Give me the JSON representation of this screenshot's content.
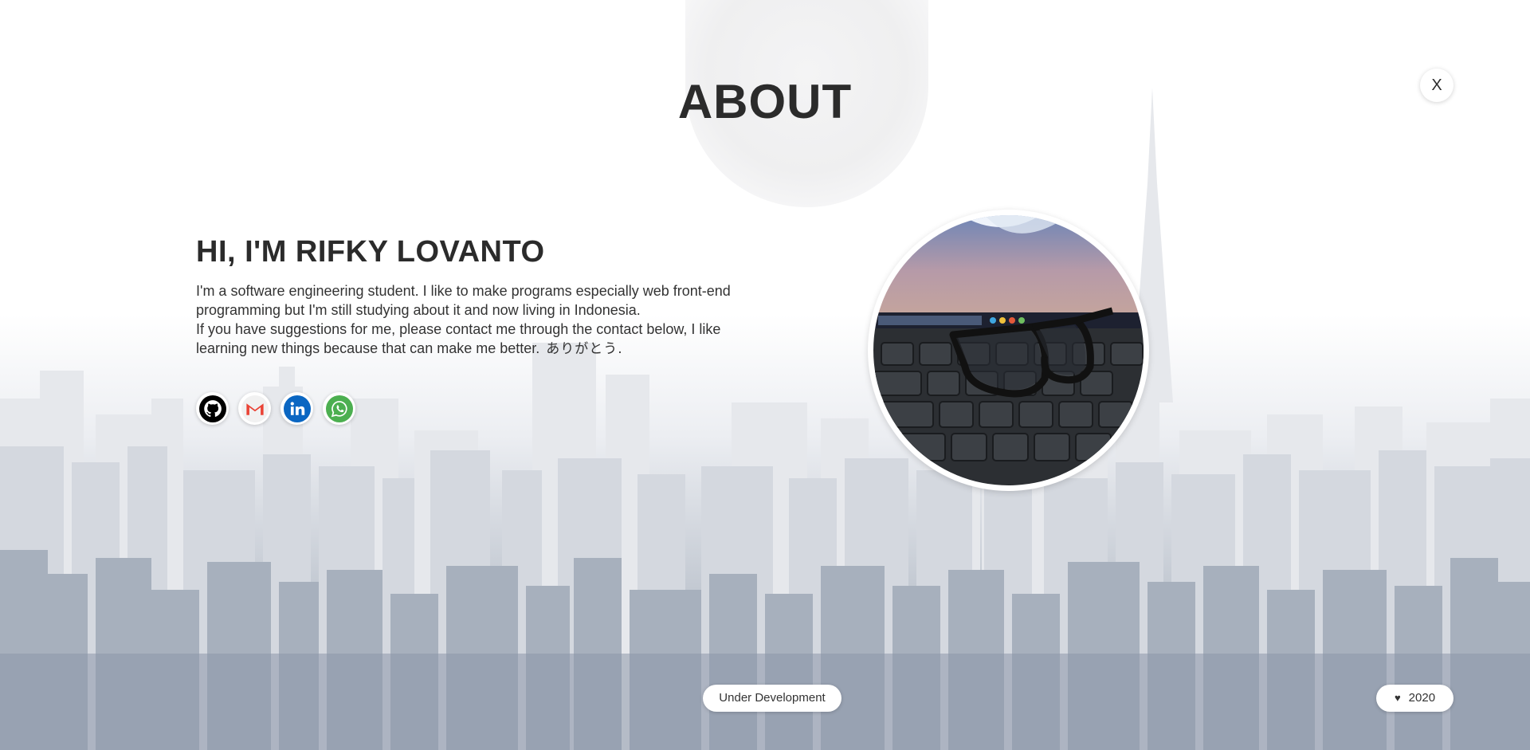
{
  "header": {
    "title": "ABOUT",
    "close_label": "X"
  },
  "intro": {
    "heading": "HI, I'M RIFKY LOVANTO",
    "paragraph_1": "I'm a software engineering student. I like to make programs especially web front-end programming but I'm still studying about it and now living in Indonesia.",
    "paragraph_2": "If you have suggestions for me, please contact me through the contact below, I like learning new things because that can make me better.",
    "thanks": "ありがとう."
  },
  "social": [
    {
      "icon": "github-icon",
      "color": "#000000"
    },
    {
      "icon": "gmail-icon",
      "color": "#ea4335"
    },
    {
      "icon": "linkedin-icon",
      "color": "#0a66c2"
    },
    {
      "icon": "whatsapp-icon",
      "color": "#4caf50"
    }
  ],
  "footer": {
    "status": "Under Development",
    "heart": "♥",
    "year": "2020"
  }
}
